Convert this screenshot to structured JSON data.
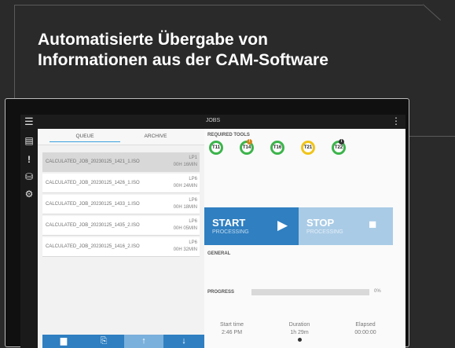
{
  "headline": {
    "line1": "Automatisierte Übergabe von",
    "line2": "Informationen aus der CAM-Software"
  },
  "app": {
    "title": "JOBS",
    "menu_icon": "☰",
    "more_icon": "⋮"
  },
  "sidebar": {
    "items": [
      {
        "icon": "list-icon",
        "glyph": "▤"
      },
      {
        "icon": "alert-icon",
        "glyph": "!"
      },
      {
        "icon": "database-icon",
        "glyph": "⛁"
      },
      {
        "icon": "settings-icon",
        "glyph": "⚙"
      }
    ]
  },
  "tabs": {
    "queue": "QUEUE",
    "archive": "ARCHIVE"
  },
  "jobs": [
    {
      "name": "CALCULATED_JOB_20230125_1421_1.ISO",
      "machine": "LP1",
      "time": "00H 16MIN",
      "selected": true
    },
    {
      "name": "CALCULATED_JOB_20230125_1426_1.ISO",
      "machine": "LP6",
      "time": "00H 24MIN",
      "selected": false
    },
    {
      "name": "CALCULATED_JOB_20230125_1433_1.ISO",
      "machine": "LP6",
      "time": "00H 18MIN",
      "selected": false
    },
    {
      "name": "CALCULATED_JOB_20230125_1435_2.ISO",
      "machine": "LP6",
      "time": "00H 05MIN",
      "selected": false
    },
    {
      "name": "CALCULATED_JOB_20230125_1416_2.ISO",
      "machine": "LP6",
      "time": "00H 32MIN",
      "selected": false
    }
  ],
  "bottom_buttons": [
    {
      "icon": "folder-icon",
      "glyph": "▆"
    },
    {
      "icon": "import-icon",
      "glyph": "⎘"
    },
    {
      "icon": "move-up-icon",
      "glyph": "↑"
    },
    {
      "icon": "move-down-icon",
      "glyph": "↓"
    }
  ],
  "tools": {
    "label": "REQUIRED TOOLS",
    "items": [
      {
        "label": "T11",
        "color": "#3cb44b",
        "badge": ""
      },
      {
        "label": "T14",
        "color": "#3cb44b",
        "badge": "!"
      },
      {
        "label": "T16",
        "color": "#3cb44b",
        "badge": ""
      },
      {
        "label": "T21",
        "color": "#f0c419",
        "badge": ""
      },
      {
        "label": "T22",
        "color": "#3cb44b",
        "badge": "i"
      }
    ]
  },
  "start": {
    "title": "START",
    "subtitle": "PROCESSING",
    "glyph": "▶"
  },
  "stop": {
    "title": "STOP",
    "subtitle": "PROCESSING",
    "glyph": "■"
  },
  "general": {
    "label": "GENERAL",
    "progress_label": "PROGRESS",
    "progress_value": "0%",
    "progress_fraction": 0
  },
  "stats": {
    "start_time_label": "Start time",
    "start_time_value": "2:46 PM",
    "duration_label": "Duration",
    "duration_value": "1h 29m",
    "elapsed_label": "Elapsed",
    "elapsed_value": "00:00:00"
  },
  "colors": {
    "accent": "#2f7fc1",
    "tool_ok": "#3cb44b",
    "tool_warn": "#f0c419"
  }
}
